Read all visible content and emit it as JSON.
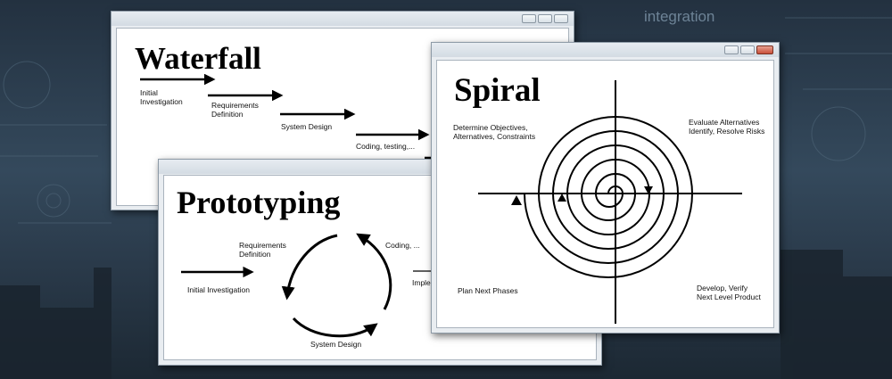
{
  "background": {
    "watermark_text": "integration"
  },
  "windows": {
    "waterfall": {
      "title": "Waterfall",
      "steps": [
        {
          "line1": "Initial",
          "line2": "Investigation"
        },
        {
          "line1": "Requirements",
          "line2": "Definition"
        },
        {
          "line1": "System Design"
        },
        {
          "line1": "Coding, testing,..."
        }
      ]
    },
    "prototyping": {
      "title": "Prototyping",
      "initial": "Initial Investigation",
      "requirements": {
        "line1": "Requirements",
        "line2": "Definition"
      },
      "coding": "Coding, ...",
      "system_design": "System Design",
      "implement": "Implem"
    },
    "spiral": {
      "title": "Spiral",
      "quadrants": {
        "top_left": {
          "line1": "Determine Objectives,",
          "line2": "Alternatives, Constraints"
        },
        "top_right": {
          "line1": "Evaluate Alternatives",
          "line2": "Identify, Resolve Risks"
        },
        "bottom_left": "Plan Next Phases",
        "bottom_right": {
          "line1": "Develop, Verify",
          "line2": "Next Level Product"
        }
      }
    }
  },
  "colors": {
    "window_frame": "#e9edf1",
    "close_button": "#c9503a",
    "diagram_ink": "#000000"
  }
}
